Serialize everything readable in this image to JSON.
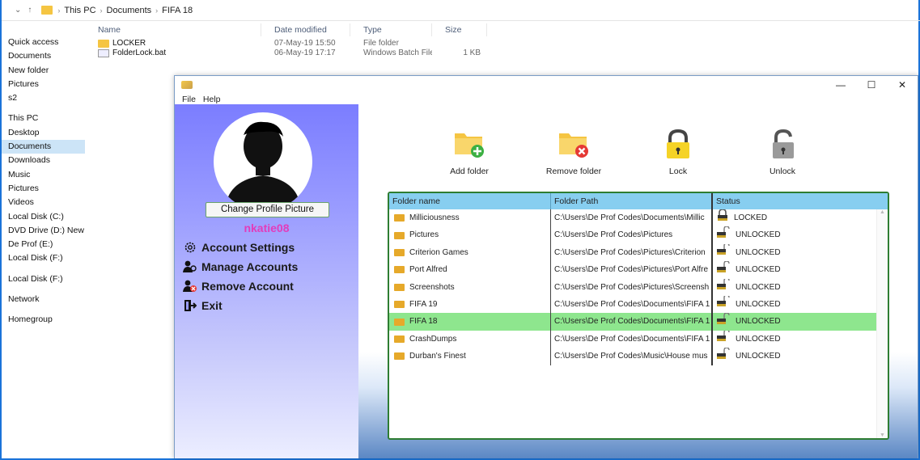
{
  "explorer": {
    "breadcrumb": [
      "This PC",
      "Documents",
      "FIFA 18"
    ],
    "nav_items": [
      "Quick access",
      "Documents",
      "New folder",
      "Pictures",
      "s2",
      "This PC",
      "Desktop",
      "Documents",
      "Downloads",
      "Music",
      "Pictures",
      "Videos",
      "Local Disk (C:)",
      "DVD Drive (D:) New",
      "De Prof (E:)",
      "Local Disk (F:)",
      "Local Disk (F:)",
      "Network",
      "Homegroup"
    ],
    "columns": {
      "name": "Name",
      "date": "Date modified",
      "type": "Type",
      "size": "Size"
    },
    "files": [
      {
        "name": "LOCKER",
        "date": "07-May-19 15:50",
        "type": "File folder",
        "size": ""
      },
      {
        "name": "FolderLock.bat",
        "date": "06-May-19 17:17",
        "type": "Windows Batch File",
        "size": "1 KB"
      }
    ]
  },
  "app": {
    "window_controls": {
      "minimize": "—",
      "maximize": "☐",
      "close": "✕"
    },
    "menu": {
      "file": "File",
      "help": "Help"
    },
    "sidebar": {
      "change_picture": "Change Profile Picture",
      "username": "nkatie08",
      "account_settings": "Account Settings",
      "manage_accounts": "Manage Accounts",
      "remove_account": "Remove Account",
      "exit": "Exit"
    },
    "toolbar": {
      "add_folder": "Add folder",
      "remove_folder": "Remove folder",
      "lock": "Lock",
      "unlock": "Unlock"
    },
    "grid": {
      "headers": {
        "name": "Folder name",
        "path": "Folder Path",
        "status": "Status"
      },
      "rows": [
        {
          "name": "Milliciousness",
          "path": "C:\\Users\\De Prof Codes\\Documents\\Millic",
          "status": "LOCKED"
        },
        {
          "name": "Pictures",
          "path": "C:\\Users\\De Prof Codes\\Pictures",
          "status": "UNLOCKED"
        },
        {
          "name": "Criterion Games",
          "path": "C:\\Users\\De Prof Codes\\Pictures\\Criterion",
          "status": "UNLOCKED"
        },
        {
          "name": "Port Alfred",
          "path": "C:\\Users\\De Prof Codes\\Pictures\\Port Alfre",
          "status": "UNLOCKED"
        },
        {
          "name": "Screenshots",
          "path": "C:\\Users\\De Prof Codes\\Pictures\\Screensh",
          "status": "UNLOCKED"
        },
        {
          "name": "FIFA 19",
          "path": "C:\\Users\\De Prof Codes\\Documents\\FIFA 1",
          "status": "UNLOCKED"
        },
        {
          "name": "FIFA 18",
          "path": "C:\\Users\\De Prof Codes\\Documents\\FIFA 1",
          "status": "UNLOCKED"
        },
        {
          "name": "CrashDumps",
          "path": "C:\\Users\\De Prof Codes\\Documents\\FIFA 1",
          "status": "UNLOCKED"
        },
        {
          "name": "Durban's Finest",
          "path": "C:\\Users\\De Prof Codes\\Music\\House mus",
          "status": "UNLOCKED"
        }
      ]
    }
  }
}
